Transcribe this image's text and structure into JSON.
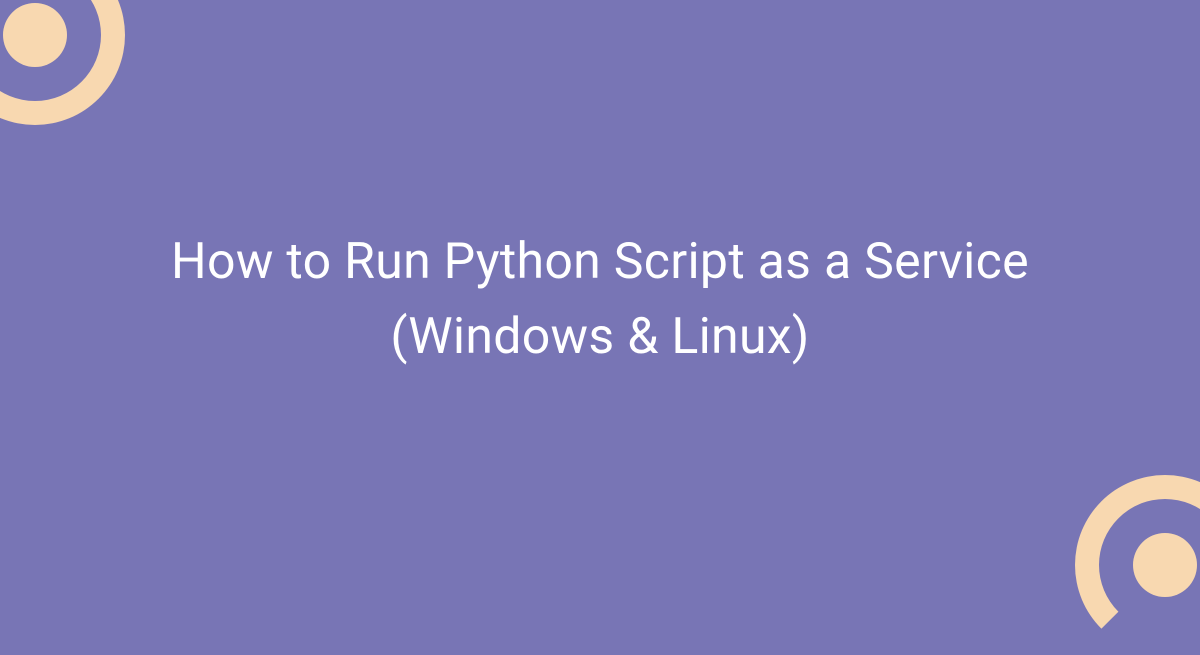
{
  "heading": {
    "text": "How to Run Python Script as a Service (Windows & Linux)"
  },
  "colors": {
    "background": "#7875b5",
    "text": "#ffffff",
    "accent": "#f8d8b0"
  }
}
